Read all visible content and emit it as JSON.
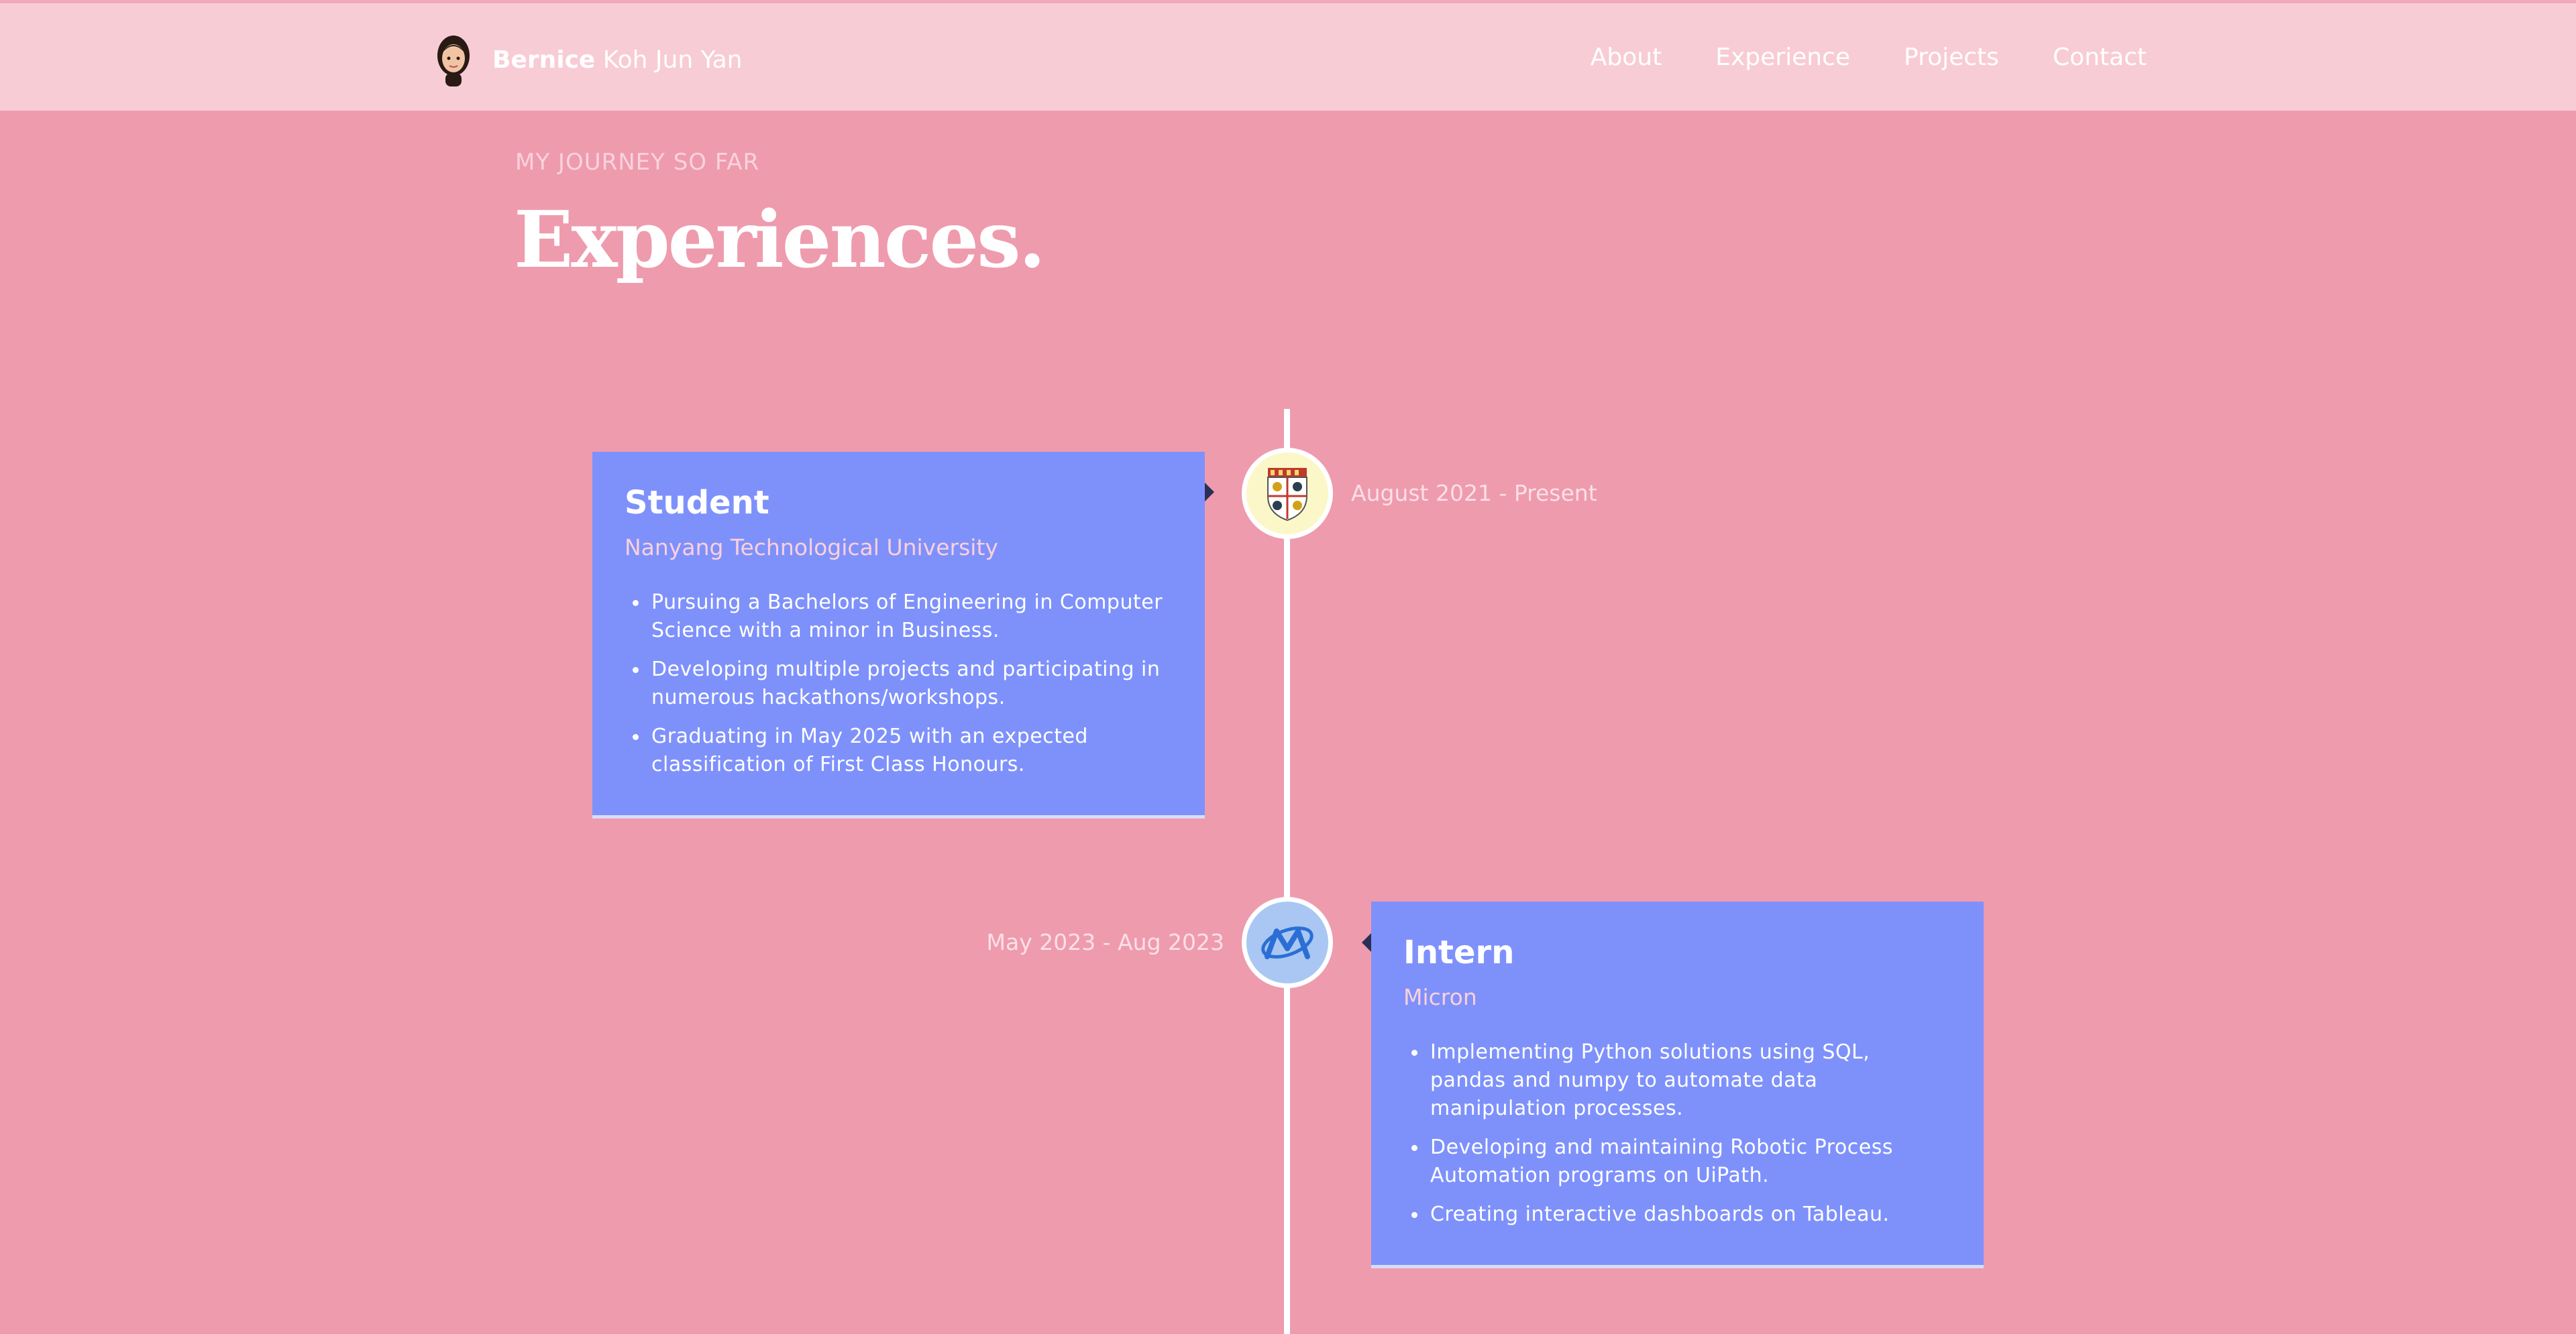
{
  "navbar": {
    "brand_first": "Bernice",
    "brand_rest": " Koh Jun Yan",
    "avatar_icon": "memoji-avatar-icon",
    "links": [
      "About",
      "Experience",
      "Projects",
      "Contact"
    ]
  },
  "section": {
    "subtitle": "MY JOURNEY SO FAR",
    "title": "Experiences."
  },
  "experiences": [
    {
      "title": "Student",
      "company": "Nanyang Technological University",
      "date": "August 2021 - Present",
      "icon": "ntu-crest-icon",
      "icon_bg": "#fbf7c8",
      "points": [
        "Pursuing a Bachelors of Engineering in Computer Science with a minor in Business.",
        "Developing multiple projects and participating in numerous hackathons/workshops.",
        "Graduating in May 2025 with an expected classification of First Class Honours."
      ]
    },
    {
      "title": "Intern",
      "company": "Micron",
      "date": "May 2023 - Aug 2023",
      "icon": "micron-logo-icon",
      "icon_bg": "#a9c7f2",
      "points": [
        "Implementing Python solutions using SQL, pandas and numpy to automate data manipulation processes.",
        "Developing and maintaining Robotic Process Automation programs on UiPath.",
        "Creating interactive dashboards on Tableau."
      ]
    }
  ],
  "colors": {
    "background": "#ee9bae",
    "navbar": "#f8ccd5",
    "card": "#7e91fb",
    "timeline": "#ffffff"
  }
}
